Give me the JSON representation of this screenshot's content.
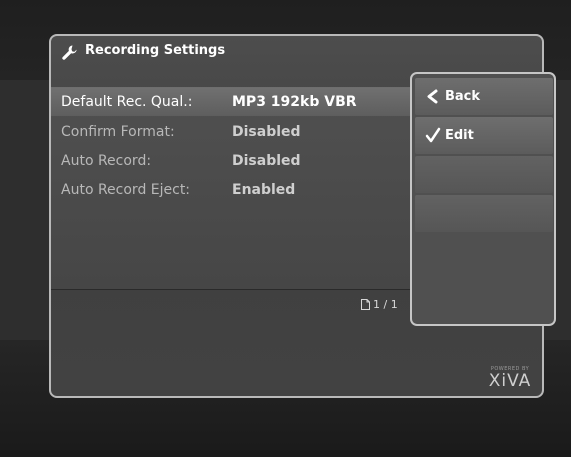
{
  "window": {
    "title": "Recording Settings",
    "title_icon": "wrench-icon"
  },
  "settings": [
    {
      "label": "Default Rec. Qual.:",
      "value": "MP3 192kb VBR",
      "selected": true
    },
    {
      "label": "Confirm Format:",
      "value": "Disabled",
      "selected": false
    },
    {
      "label": "Auto Record:",
      "value": "Disabled",
      "selected": false
    },
    {
      "label": "Auto Record Eject:",
      "value": "Enabled",
      "selected": false
    }
  ],
  "pager": {
    "text": "1 / 1",
    "icon": "page-icon"
  },
  "menu": {
    "items": [
      {
        "label": "Back",
        "icon": "back-chevron-icon"
      },
      {
        "label": "Edit",
        "icon": "check-icon"
      },
      {
        "label": "",
        "icon": ""
      },
      {
        "label": "",
        "icon": ""
      }
    ]
  },
  "branding": {
    "powered_by": "POWERED BY",
    "logo": "XiVA"
  },
  "colors": {
    "panel_border": "#b9b9b9",
    "selected_row": "#707070",
    "background": "#1c1c1c"
  }
}
